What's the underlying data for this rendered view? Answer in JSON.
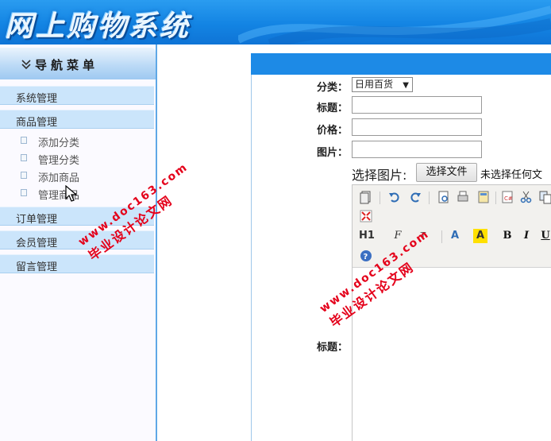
{
  "app": {
    "title": "网上购物系统"
  },
  "nav": {
    "header": "导航菜单",
    "categories": [
      {
        "label": "系统管理"
      },
      {
        "label": "商品管理",
        "items": [
          "添加分类",
          "管理分类",
          "添加商品",
          "管理商品"
        ]
      },
      {
        "label": "订单管理"
      },
      {
        "label": "会员管理"
      },
      {
        "label": "留言管理"
      }
    ]
  },
  "form": {
    "category_label": "分类：",
    "category_value": "日用百货",
    "title_label": "标题：",
    "price_label": "价格：",
    "image_label": "图片：",
    "file_prompt": "选择图片:",
    "file_button": "选择文件",
    "file_status": "未选择任何文",
    "content_label": "标题："
  },
  "editor": {
    "toolbar_row1": [
      "source-icon",
      "undo-icon",
      "redo-icon",
      "preview-icon",
      "print-icon",
      "template-icon",
      "code-icon",
      "cut-icon",
      "copy-icon"
    ],
    "toolbar_row2": [
      "fullscreen-icon"
    ],
    "toolbar_row3": [
      "H1",
      "F",
      "T",
      "A",
      "A",
      "B",
      "I",
      "U"
    ],
    "toolbar_row4": [
      "help-icon"
    ]
  },
  "watermarks": [
    {
      "line1": "www.doc163.com",
      "line2": "毕业设计论文网"
    },
    {
      "line1": "www.doc163.com",
      "line2": "毕业设计论文网"
    }
  ],
  "colors": {
    "banner": "#1384e3",
    "accent": "#1d8ae6",
    "menu": "#cbe5fb",
    "watermark": "#e4001a"
  }
}
